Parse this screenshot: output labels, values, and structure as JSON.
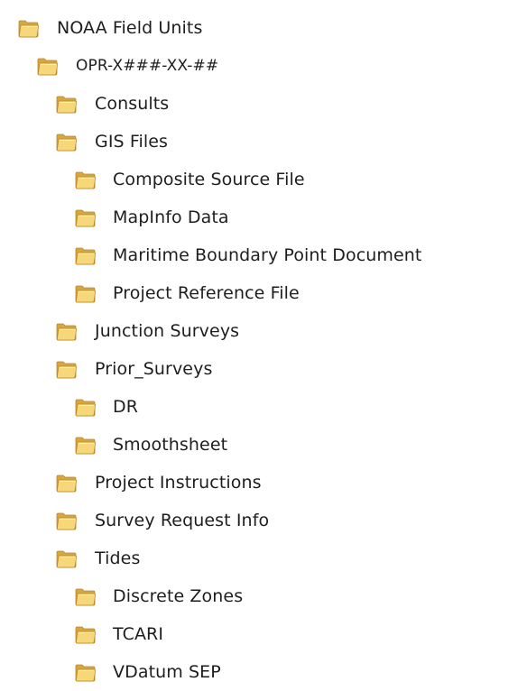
{
  "tree": {
    "icon": "folder-icon",
    "colors": {
      "folder_back": "#d9a63a",
      "folder_front": "#f6d77a",
      "folder_highlight": "#fff1b8",
      "folder_edge": "#b9862a"
    },
    "items": [
      {
        "id": "noaa-field-units",
        "label": "NOAA Field Units",
        "level": 0
      },
      {
        "id": "opr-x-xx",
        "label": "OPR-X###-XX-##",
        "level": 1
      },
      {
        "id": "consults",
        "label": "Consults",
        "level": 2
      },
      {
        "id": "gis-files",
        "label": "GIS Files",
        "level": 2
      },
      {
        "id": "composite-source-file",
        "label": "Composite Source File",
        "level": 3
      },
      {
        "id": "mapinfo-data",
        "label": "MapInfo Data",
        "level": 3
      },
      {
        "id": "maritime-boundary-point-document",
        "label": "Maritime Boundary Point Document",
        "level": 3
      },
      {
        "id": "project-reference-file",
        "label": "Project Reference File",
        "level": 3
      },
      {
        "id": "junction-surveys",
        "label": "Junction Surveys",
        "level": 2
      },
      {
        "id": "prior-surveys",
        "label": "Prior_Surveys",
        "level": 2
      },
      {
        "id": "dr",
        "label": "DR",
        "level": 3
      },
      {
        "id": "smoothsheet",
        "label": "Smoothsheet",
        "level": 3
      },
      {
        "id": "project-instructions",
        "label": "Project Instructions",
        "level": 2
      },
      {
        "id": "survey-request-info",
        "label": "Survey Request Info",
        "level": 2
      },
      {
        "id": "tides",
        "label": "Tides",
        "level": 2
      },
      {
        "id": "discrete-zones",
        "label": "Discrete Zones",
        "level": 3
      },
      {
        "id": "tcari",
        "label": "TCARI",
        "level": 3
      },
      {
        "id": "vdatum-sep",
        "label": "VDatum SEP",
        "level": 3
      }
    ]
  }
}
